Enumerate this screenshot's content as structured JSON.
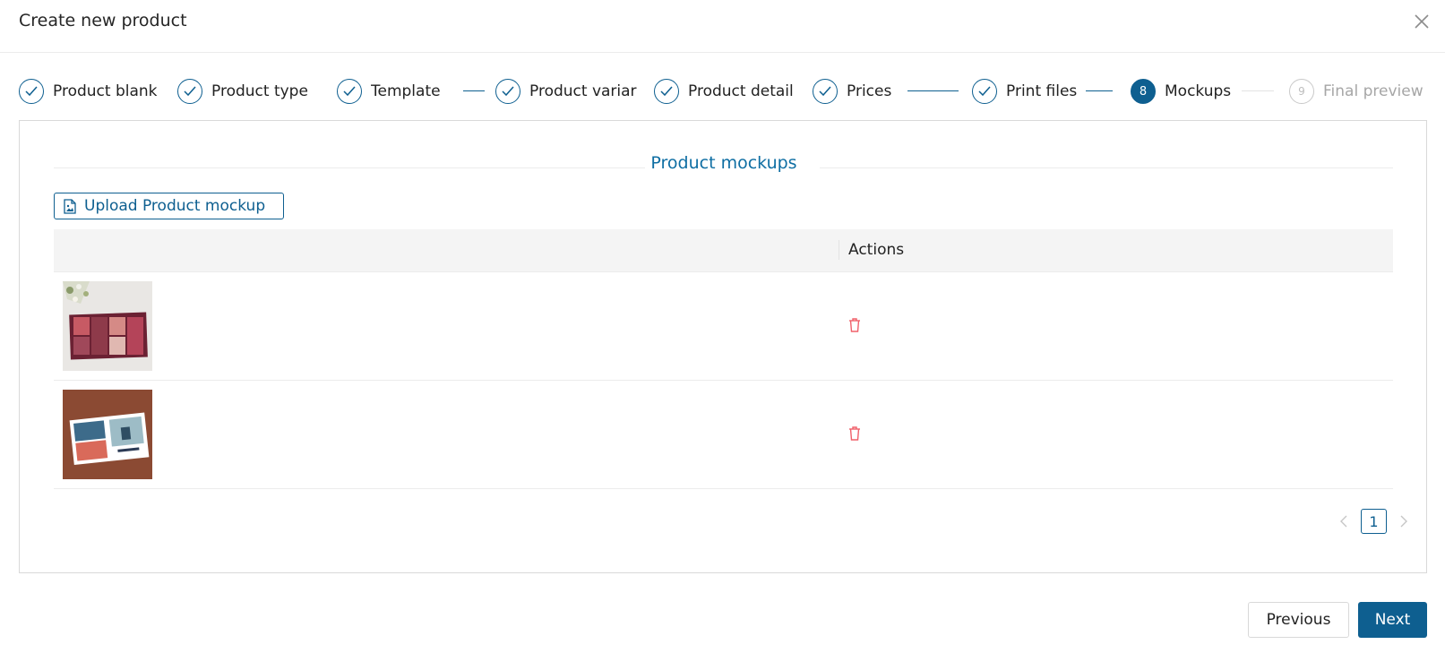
{
  "modal": {
    "title": "Create new product"
  },
  "steps": [
    {
      "label": "Product blank",
      "status": "done"
    },
    {
      "label": "Product type",
      "status": "done"
    },
    {
      "label": "Template",
      "status": "done"
    },
    {
      "label": "Product variar",
      "status": "done"
    },
    {
      "label": "Product detail",
      "status": "done"
    },
    {
      "label": "Prices",
      "status": "done"
    },
    {
      "label": "Print files",
      "status": "done"
    },
    {
      "label": "Mockups",
      "status": "active",
      "number": "8"
    },
    {
      "label": "Final preview",
      "status": "pending",
      "number": "9"
    }
  ],
  "section": {
    "title": "Product mockups"
  },
  "upload": {
    "label": "Upload Product mockup",
    "icon": "file-image-icon"
  },
  "table": {
    "columns": [
      "",
      "Actions"
    ],
    "rows": [
      {
        "image": "photo-album-mockup-flowers",
        "action_icon": "trash-icon"
      },
      {
        "image": "photo-album-mockup-brown",
        "action_icon": "trash-icon"
      }
    ]
  },
  "pagination": {
    "current_page": "1",
    "prev_icon": "chevron-left-icon",
    "next_icon": "chevron-right-icon"
  },
  "footer": {
    "previous_label": "Previous",
    "next_label": "Next"
  },
  "colors": {
    "primary": "#0e5f90",
    "danger": "#f0606a",
    "pending": "#bdbdbd"
  }
}
